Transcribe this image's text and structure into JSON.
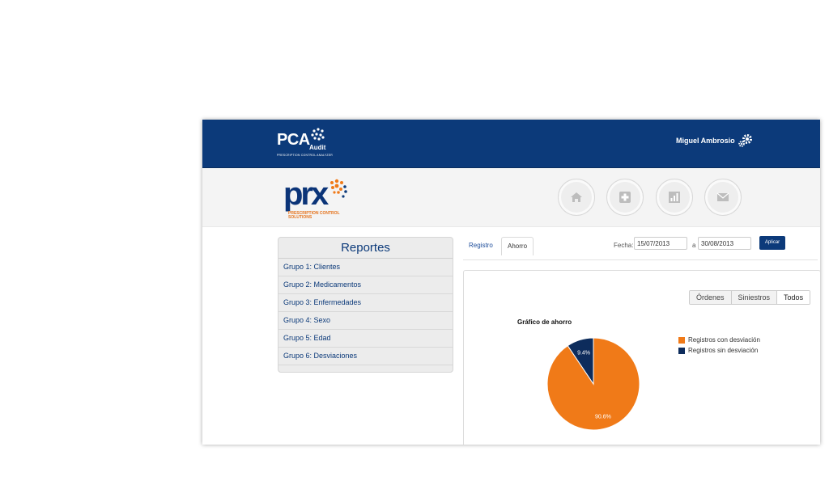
{
  "header": {
    "logo_main": "PCA",
    "logo_audit": "Audit",
    "logo_sub": "PRESCRIPTION CONTROL ANALYZER",
    "user_name": "Miguel Ambrosio"
  },
  "brand": {
    "logo_text": "prx",
    "logo_sub": "PRESCRIPTION CONTROL SOLUTIONS"
  },
  "nav": [
    {
      "icon": "home-icon"
    },
    {
      "icon": "medical-cross-icon"
    },
    {
      "icon": "bar-chart-icon"
    },
    {
      "icon": "mail-icon"
    }
  ],
  "sidebar": {
    "title": "Reportes",
    "items": [
      {
        "label": "Grupo 1: Clientes"
      },
      {
        "label": "Grupo 2: Medicamentos"
      },
      {
        "label": "Grupo 3: Enfermedades"
      },
      {
        "label": "Grupo 4: Sexo"
      },
      {
        "label": "Grupo 5: Edad"
      },
      {
        "label": "Grupo 6: Desviaciones"
      }
    ]
  },
  "tabs": [
    {
      "label": "Registro",
      "active": true
    },
    {
      "label": "Ahorro",
      "active": false
    }
  ],
  "filters": {
    "fecha_label": "Fecha:",
    "from": "15/07/2013",
    "to_label": "a",
    "to": "30/08/2013",
    "apply_label": "Aplicar"
  },
  "segment": {
    "options": [
      "Órdenes",
      "Siniestros",
      "Todos"
    ],
    "selected": "Todos"
  },
  "colors": {
    "brand_blue": "#0c3a7a",
    "orange": "#f07a18",
    "navy": "#0d2c5c"
  },
  "chart_data": {
    "type": "pie",
    "title": "Gráfico de ahorro",
    "labels": [
      "Registros con desviación",
      "Registros sin desviación"
    ],
    "values": [
      90.6,
      9.4
    ],
    "value_labels": [
      "90.6%",
      "9.4%"
    ],
    "colors": [
      "#f07a18",
      "#0d2c5c"
    ],
    "legend": "top-right"
  }
}
